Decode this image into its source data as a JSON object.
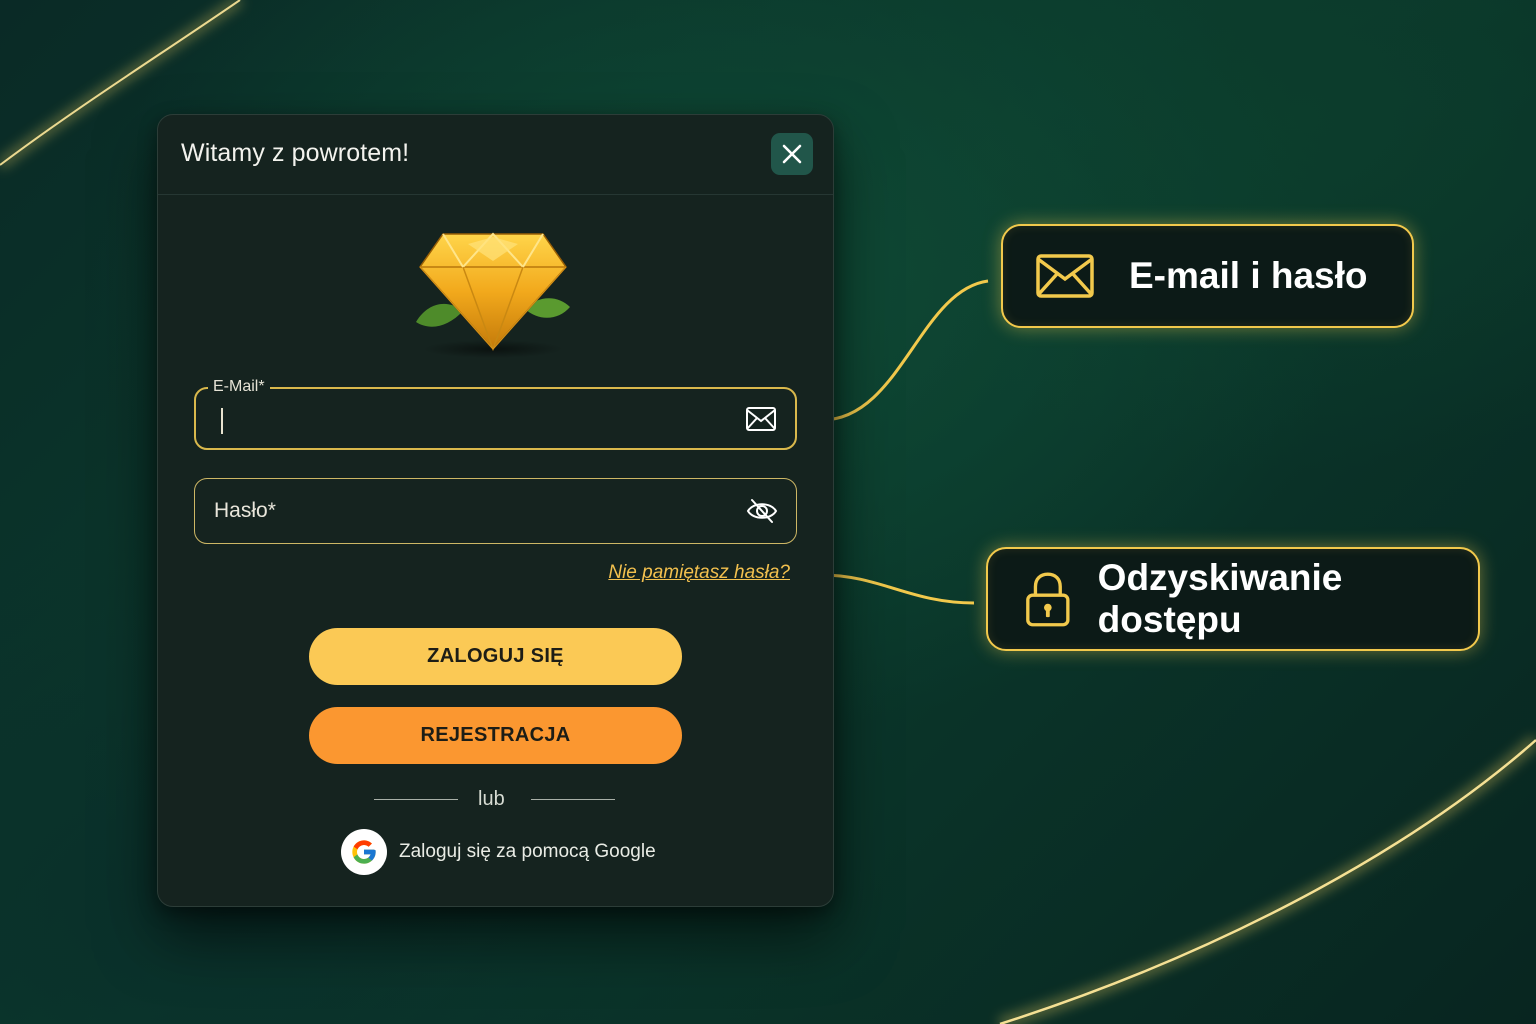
{
  "modal": {
    "title": "Witamy z powrotem!",
    "close_icon": "close-icon",
    "logo": "diamond-logo"
  },
  "form": {
    "email_label": "E-Mail*",
    "email_value": "",
    "email_icon": "envelope-icon",
    "password_placeholder": "Hasło*",
    "password_icon": "eye-slash-icon",
    "forgot_link": "Nie pamiętasz hasła?",
    "login_button": "ZALOGUJ SIĘ",
    "register_button": "REJESTRACJA",
    "divider_text": "lub",
    "google_button": "Zaloguj się za pomocą Google"
  },
  "callouts": [
    {
      "label": "E-mail i hasło",
      "icon": "envelope-icon"
    },
    {
      "label": "Odzyskiwanie dostępu",
      "icon": "lock-icon"
    }
  ],
  "colors": {
    "accent_gold": "#f2c94c",
    "login_button": "#fbc955",
    "register_button": "#fb9730",
    "modal_bg": "#15231f",
    "close_button_bg": "#21564a"
  }
}
